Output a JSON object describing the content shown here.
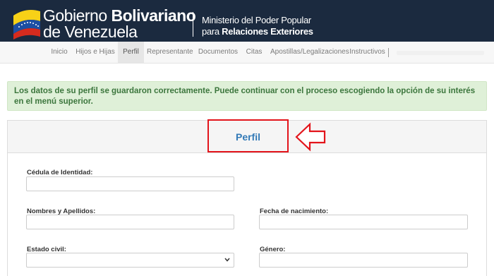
{
  "header": {
    "brand_prefix": "Gobierno ",
    "brand_bold": "Bolivariano",
    "brand_line2": "de Venezuela",
    "ministry_line1": "Ministerio del Poder Popular",
    "ministry_line2_prefix": "para ",
    "ministry_line2_bold": "Relaciones Exteriores",
    "flag_colors": [
      "#f7d117",
      "#1c4fa3",
      "#d52b1e"
    ]
  },
  "nav": {
    "items": [
      {
        "label": "Inicio"
      },
      {
        "label": "Hijos e Hijas"
      },
      {
        "label": "Perfil",
        "active": true
      },
      {
        "label": "Representante"
      },
      {
        "label": "Documentos"
      },
      {
        "label": "Citas"
      },
      {
        "label": "Apostillas/Legalizaciones"
      },
      {
        "label": "Instructivos"
      }
    ]
  },
  "alert": {
    "message": "Los datos de su perfil se guardaron correctamente. Puede continuar con el proceso escogiendo la opción de su interés en el menú superior."
  },
  "panel": {
    "title": "Perfil",
    "highlight_color": "#e3141b"
  },
  "form": {
    "cedula_label": "Cédula de Identidad:",
    "cedula_value": "",
    "nombres_label": "Nombres y Apellidos:",
    "nombres_value": "",
    "fecha_label": "Fecha de nacimiento:",
    "fecha_value": "",
    "estado_label": "Estado civil:",
    "estado_value": "",
    "genero_label": "Género:",
    "genero_value": ""
  }
}
